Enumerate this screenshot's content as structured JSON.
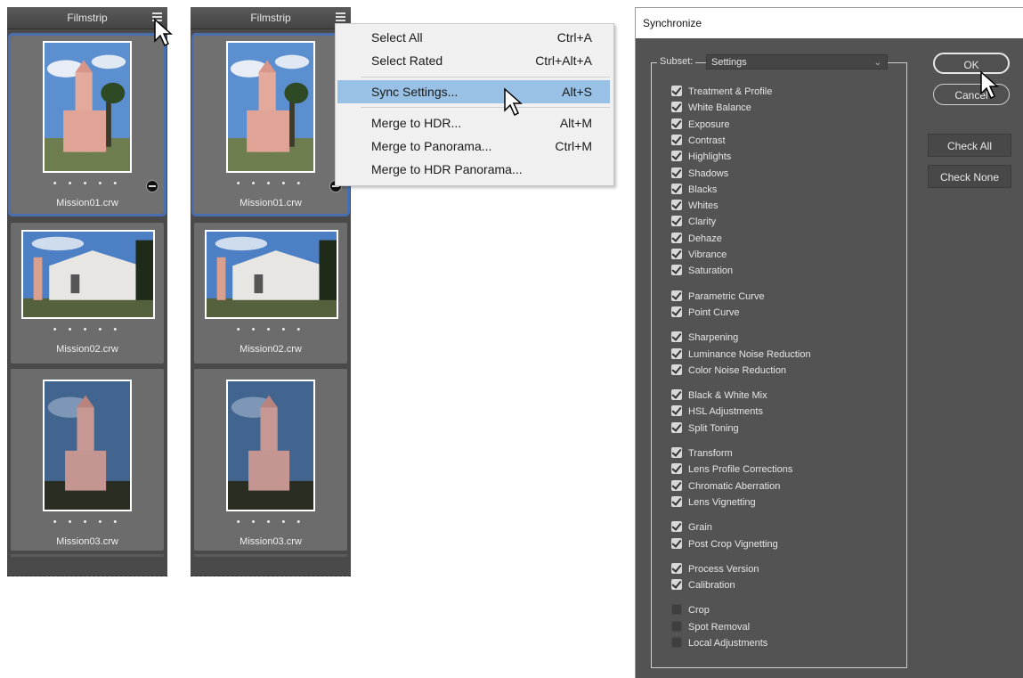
{
  "filmstrip_left": {
    "title": "Filmstrip",
    "items": [
      {
        "filename": "Mission01.crw",
        "dots": "• • • • •"
      },
      {
        "filename": "Mission02.crw",
        "dots": "• • • • •"
      },
      {
        "filename": "Mission03.crw",
        "dots": "• • • • •"
      }
    ]
  },
  "filmstrip_right": {
    "title": "Filmstrip",
    "items": [
      {
        "filename": "Mission01.crw",
        "dots": "• • • • •"
      },
      {
        "filename": "Mission02.crw",
        "dots": "• • • • •"
      },
      {
        "filename": "Mission03.crw",
        "dots": "• • • • •"
      }
    ]
  },
  "context_menu": {
    "items": [
      {
        "label": "Select All",
        "shortcut": "Ctrl+A"
      },
      {
        "label": "Select Rated",
        "shortcut": "Ctrl+Alt+A"
      },
      {
        "label": "Sync Settings...",
        "shortcut": "Alt+S",
        "highlighted": true
      },
      {
        "label": "Merge to HDR...",
        "shortcut": "Alt+M"
      },
      {
        "label": "Merge to Panorama...",
        "shortcut": "Ctrl+M"
      },
      {
        "label": "Merge to HDR Panorama...",
        "shortcut": ""
      }
    ]
  },
  "dialog": {
    "title": "Synchronize",
    "subset_label": "Subset:",
    "subset_value": "Settings",
    "buttons": {
      "ok": "OK",
      "cancel": "Cancel",
      "check_all": "Check All",
      "check_none": "Check None"
    },
    "settings": [
      {
        "label": "Treatment & Profile",
        "checked": true
      },
      {
        "label": "White Balance",
        "checked": true
      },
      {
        "label": "Exposure",
        "checked": true
      },
      {
        "label": "Contrast",
        "checked": true
      },
      {
        "label": "Highlights",
        "checked": true
      },
      {
        "label": "Shadows",
        "checked": true
      },
      {
        "label": "Blacks",
        "checked": true
      },
      {
        "label": "Whites",
        "checked": true
      },
      {
        "label": "Clarity",
        "checked": true
      },
      {
        "label": "Dehaze",
        "checked": true
      },
      {
        "label": "Vibrance",
        "checked": true
      },
      {
        "label": "Saturation",
        "checked": true
      },
      {
        "label": "Parametric Curve",
        "checked": true
      },
      {
        "label": "Point Curve",
        "checked": true
      },
      {
        "label": "Sharpening",
        "checked": true
      },
      {
        "label": "Luminance Noise Reduction",
        "checked": true
      },
      {
        "label": "Color Noise Reduction",
        "checked": true
      },
      {
        "label": "Black & White Mix",
        "checked": true
      },
      {
        "label": "HSL Adjustments",
        "checked": true
      },
      {
        "label": "Split Toning",
        "checked": true
      },
      {
        "label": "Transform",
        "checked": true
      },
      {
        "label": "Lens Profile Corrections",
        "checked": true
      },
      {
        "label": "Chromatic Aberration",
        "checked": true
      },
      {
        "label": "Lens Vignetting",
        "checked": true
      },
      {
        "label": "Grain",
        "checked": true
      },
      {
        "label": "Post Crop Vignetting",
        "checked": true
      },
      {
        "label": "Process Version",
        "checked": true
      },
      {
        "label": "Calibration",
        "checked": true
      },
      {
        "label": "Crop",
        "checked": false
      },
      {
        "label": "Spot Removal",
        "checked": false
      },
      {
        "label": "Local Adjustments",
        "checked": false
      }
    ]
  },
  "colors": {
    "panel_bg": "#4a4a4a",
    "selection_border": "#4a6fb1",
    "menu_highlight": "#99c1e6",
    "dialog_bg": "#535353"
  }
}
